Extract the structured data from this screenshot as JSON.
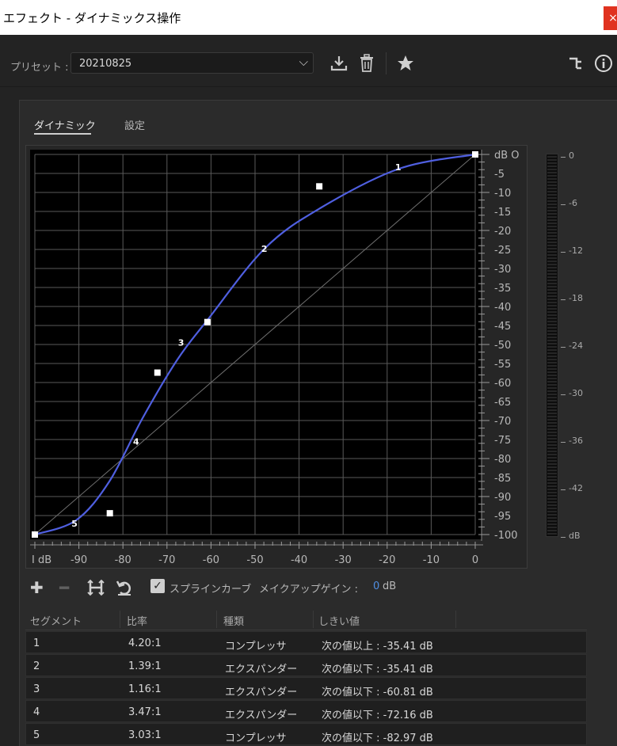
{
  "window": {
    "title": "エフェクト - ダイナミックス操作",
    "close_glyph": "×"
  },
  "toolbar": {
    "preset_label": "プリセット :",
    "preset_value": "20210825"
  },
  "tabs": [
    {
      "label": "ダイナミック",
      "active": true
    },
    {
      "label": "設定",
      "active": false
    }
  ],
  "graph": {
    "x_ticks": [
      "I dB",
      "-90",
      "-80",
      "-70",
      "-60",
      "-50",
      "-40",
      "-30",
      "-20",
      "-10",
      "0"
    ],
    "y_ticks": [
      "dB O",
      "-5",
      "-10",
      "-15",
      "-20",
      "-25",
      "-30",
      "-35",
      "-40",
      "-45",
      "-50",
      "-55",
      "-60",
      "-65",
      "-70",
      "-75",
      "-80",
      "-85",
      "-90",
      "-95",
      "-100"
    ],
    "control_points": [
      {
        "x": -100,
        "y": -100
      },
      {
        "x": -82.97,
        "y": -94.4
      },
      {
        "x": -72.16,
        "y": -57.4
      },
      {
        "x": -60.81,
        "y": -44.1
      },
      {
        "x": -35.41,
        "y": -8.4
      },
      {
        "x": 0,
        "y": 0
      }
    ],
    "segment_labels": [
      {
        "label": "1",
        "x": -17.5,
        "y": -3.3
      },
      {
        "label": "2",
        "x": -47.9,
        "y": -24.8
      },
      {
        "label": "3",
        "x": -66.8,
        "y": -49.5
      },
      {
        "label": "4",
        "x": -77,
        "y": -75.5
      },
      {
        "label": "5",
        "x": -91,
        "y": -97.1
      }
    ],
    "curve_color": "#4f5fe0",
    "meter_ticks": [
      "0",
      "-6",
      "-12",
      "-18",
      "-24",
      "-30",
      "-36",
      "-42",
      "dB"
    ]
  },
  "tools": {
    "spline_label": "スプラインカーブ",
    "makeup_label": "メイクアップゲイン :",
    "makeup_value": "0",
    "makeup_unit": "dB"
  },
  "table": {
    "headers": [
      "セグメント",
      "比率",
      "種類",
      "しきい値"
    ],
    "rows": [
      [
        "1",
        "4.20:1",
        "コンプレッサ",
        "次の値以上 : -35.41 dB"
      ],
      [
        "2",
        "1.39:1",
        "エクスパンダー",
        "次の値以下 : -35.41 dB"
      ],
      [
        "3",
        "1.16:1",
        "エクスパンダー",
        "次の値以下 : -60.81 dB"
      ],
      [
        "4",
        "3.47:1",
        "エクスパンダー",
        "次の値以下 : -72.16 dB"
      ],
      [
        "5",
        "3.03:1",
        "コンプレッサ",
        "次の値以下 : -82.97 dB"
      ]
    ]
  }
}
